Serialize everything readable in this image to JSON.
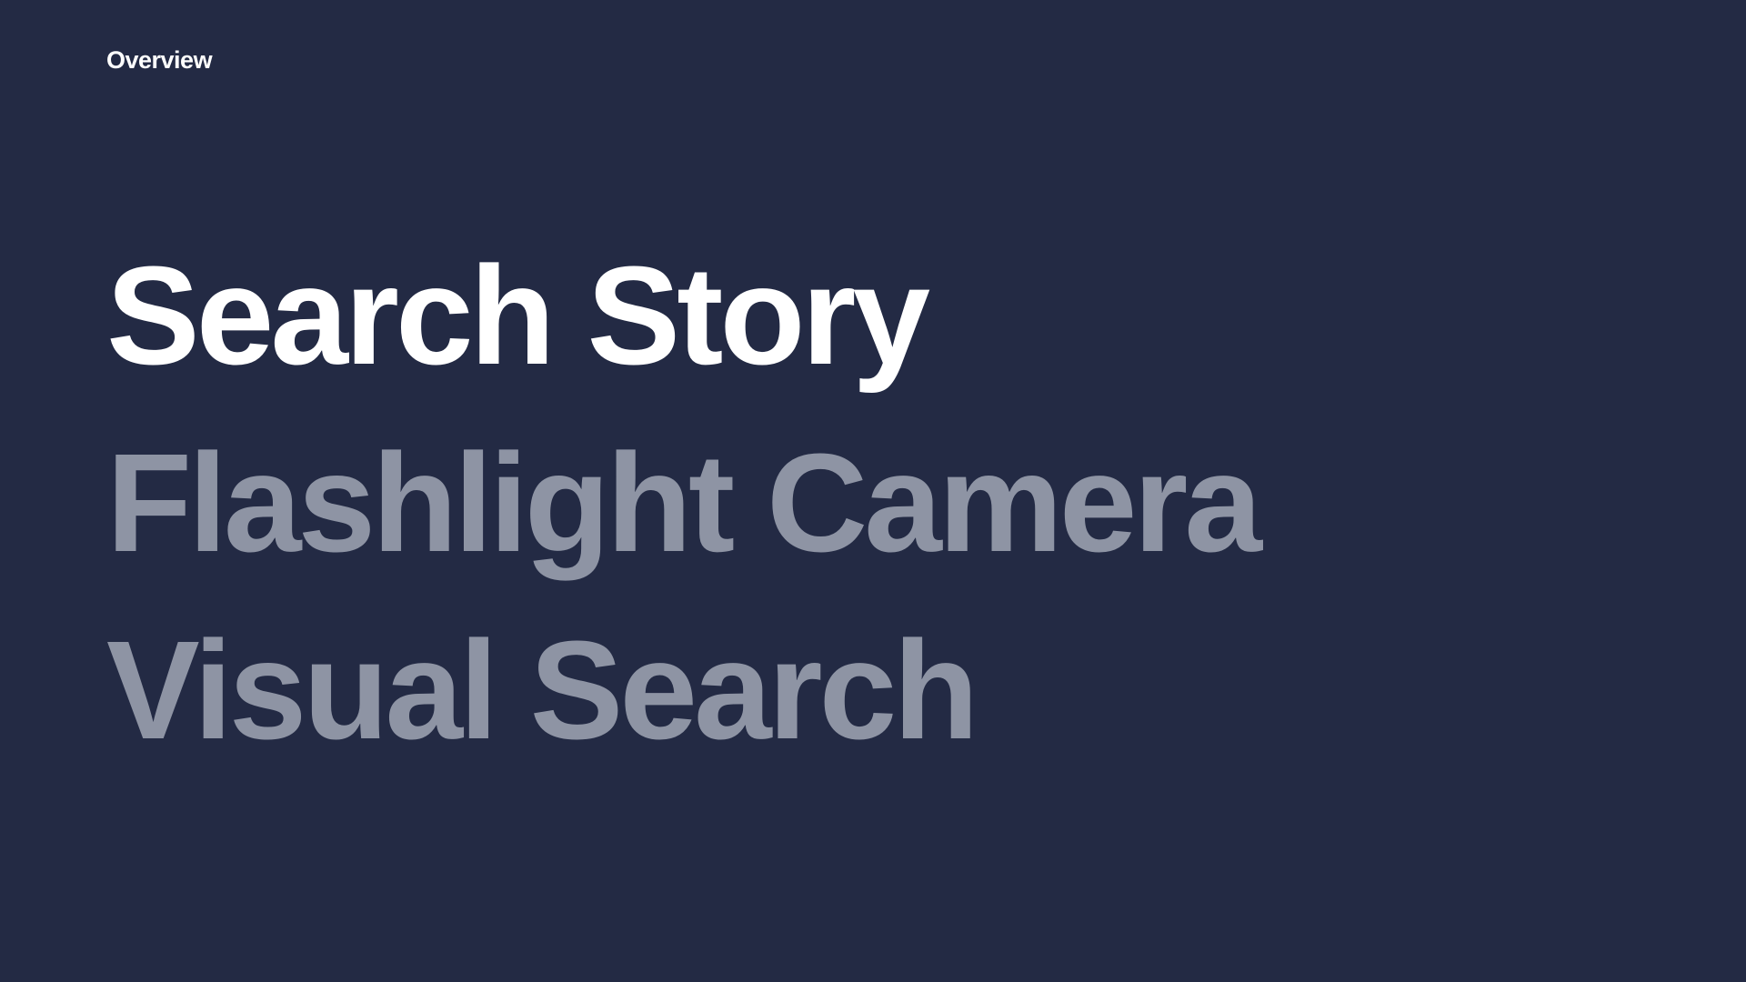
{
  "slide": {
    "section_label": "Overview",
    "colors": {
      "background": "#232a44",
      "active_text": "#ffffff",
      "inactive_text": "#8e94a4"
    },
    "agenda": [
      {
        "label": "Search Story",
        "active": true
      },
      {
        "label": "Flashlight Camera",
        "active": false
      },
      {
        "label": "Visual Search",
        "active": false
      }
    ]
  }
}
